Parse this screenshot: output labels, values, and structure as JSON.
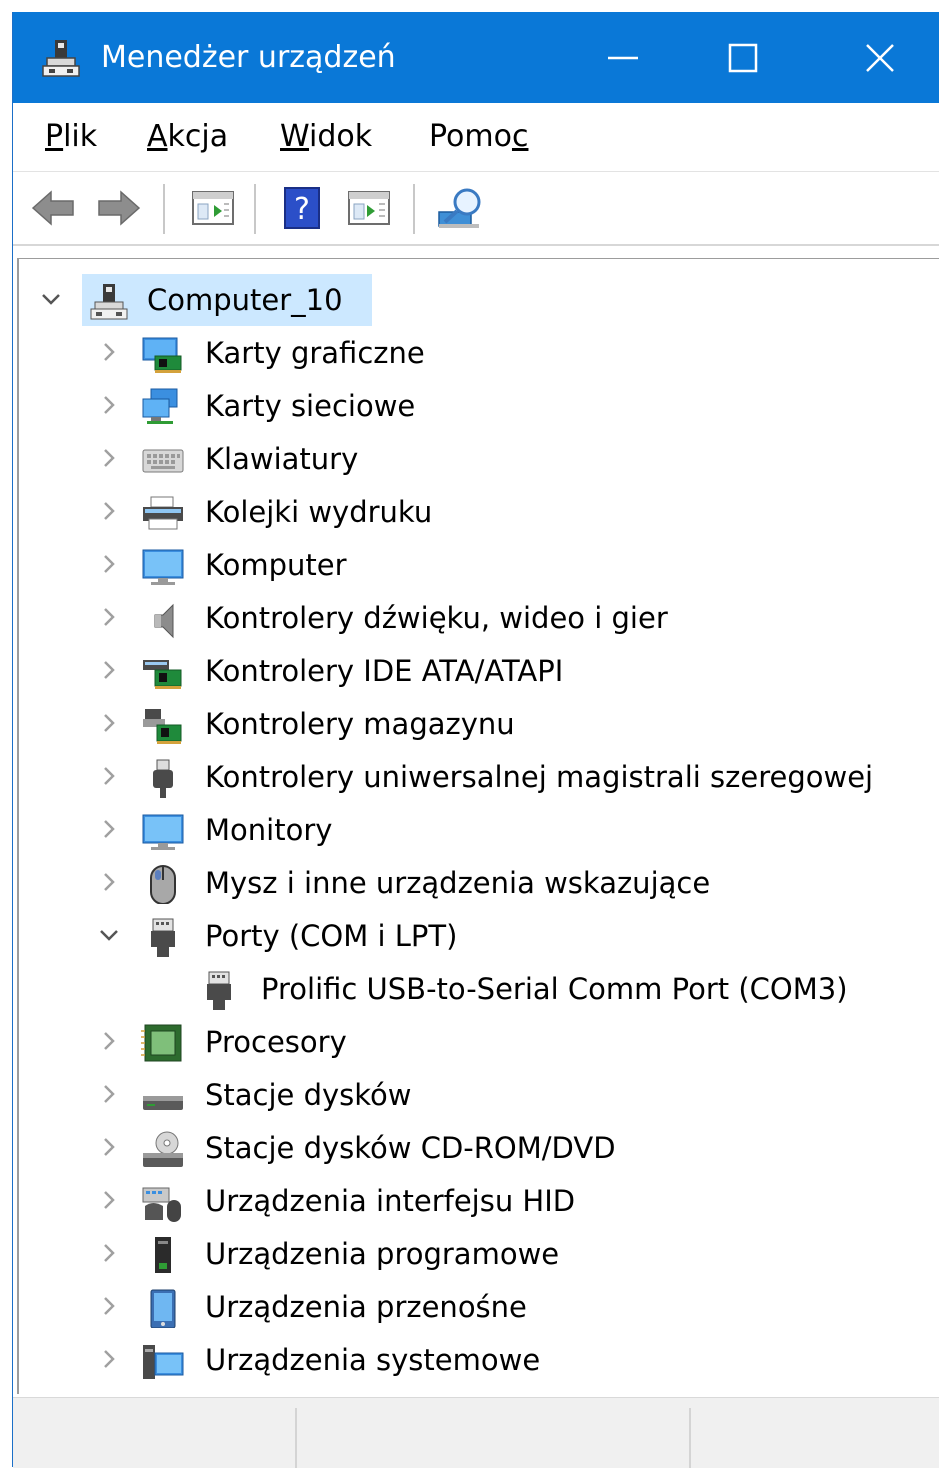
{
  "window": {
    "title": "Menedżer urządzeń",
    "colors": {
      "titlebar": "#0a78d7",
      "selection": "#cce8ff"
    }
  },
  "menu": [
    {
      "pre": "",
      "u": "P",
      "post": "lik"
    },
    {
      "pre": "",
      "u": "A",
      "post": "kcja"
    },
    {
      "pre": "",
      "u": "W",
      "post": "idok"
    },
    {
      "pre": "Pomo",
      "u": "c",
      "post": ""
    }
  ],
  "toolbar": [
    "back-arrow-icon",
    "forward-arrow-icon",
    "properties-icon",
    "help-icon",
    "run-icon",
    "scan-hardware-icon"
  ],
  "tree": {
    "root": {
      "label": "Computer_10",
      "icon": "computer-icon",
      "expanded": true
    },
    "categories": [
      {
        "label": "Karty graficzne",
        "icon": "display-adapter-icon"
      },
      {
        "label": "Karty sieciowe",
        "icon": "network-adapter-icon"
      },
      {
        "label": "Klawiatury",
        "icon": "keyboard-icon"
      },
      {
        "label": "Kolejki wydruku",
        "icon": "printer-icon"
      },
      {
        "label": "Komputer",
        "icon": "monitor-icon"
      },
      {
        "label": "Kontrolery dźwięku, wideo i gier",
        "icon": "speaker-icon"
      },
      {
        "label": "Kontrolery IDE ATA/ATAPI",
        "icon": "ide-controller-icon"
      },
      {
        "label": "Kontrolery magazynu",
        "icon": "storage-controller-icon"
      },
      {
        "label": "Kontrolery uniwersalnej magistrali szeregowej",
        "icon": "usb-icon"
      },
      {
        "label": "Monitory",
        "icon": "monitor-icon"
      },
      {
        "label": "Mysz i inne urządzenia wskazujące",
        "icon": "mouse-icon"
      },
      {
        "label": "Porty (COM i LPT)",
        "icon": "port-icon",
        "expanded": true,
        "children": [
          {
            "label": "Prolific USB-to-Serial Comm Port (COM3)",
            "icon": "port-icon"
          }
        ]
      },
      {
        "label": "Procesory",
        "icon": "processor-icon"
      },
      {
        "label": "Stacje dysków",
        "icon": "disk-drive-icon"
      },
      {
        "label": "Stacje dysków CD-ROM/DVD",
        "icon": "cdrom-icon"
      },
      {
        "label": "Urządzenia interfejsu HID",
        "icon": "hid-icon"
      },
      {
        "label": "Urządzenia programowe",
        "icon": "software-device-icon"
      },
      {
        "label": "Urządzenia przenośne",
        "icon": "portable-device-icon"
      },
      {
        "label": "Urządzenia systemowe",
        "icon": "system-device-icon"
      }
    ]
  }
}
